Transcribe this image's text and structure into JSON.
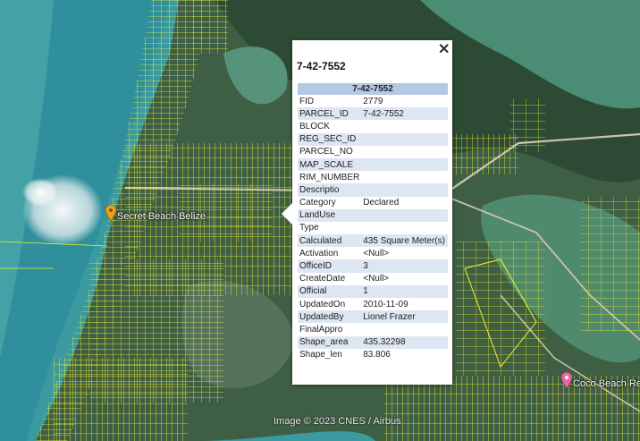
{
  "map": {
    "places": [
      {
        "name": "Secret Beach Belize",
        "pin_color": "#e8a21c"
      },
      {
        "name": "Coco Beach Re",
        "pin_color": "#e86aa0"
      }
    ],
    "credit": "Image © 2023 CNES / Airbus",
    "parcel_color": "#f2f22a",
    "water_color": "#3f9fa0"
  },
  "popup": {
    "title": "7-42-7552",
    "close_icon": "close-icon",
    "table_header": "7-42-7552",
    "rows": [
      {
        "k": "FID",
        "v": "2779"
      },
      {
        "k": "PARCEL_ID",
        "v": "7-42-7552"
      },
      {
        "k": "BLOCK",
        "v": ""
      },
      {
        "k": "REG_SEC_ID",
        "v": ""
      },
      {
        "k": "PARCEL_NO",
        "v": ""
      },
      {
        "k": "MAP_SCALE",
        "v": ""
      },
      {
        "k": "RIM_NUMBER",
        "v": ""
      },
      {
        "k": "Descriptio",
        "v": ""
      },
      {
        "k": "Category",
        "v": "Declared"
      },
      {
        "k": "LandUse",
        "v": ""
      },
      {
        "k": "Type",
        "v": ""
      },
      {
        "k": "Calculated",
        "v": "435 Square Meter(s)"
      },
      {
        "k": "Activation",
        "v": "<Null>"
      },
      {
        "k": "OfficeID",
        "v": "3"
      },
      {
        "k": "CreateDate",
        "v": "<Null>"
      },
      {
        "k": "Official",
        "v": "1"
      },
      {
        "k": "UpdatedOn",
        "v": "2010-11-09"
      },
      {
        "k": "UpdatedBy",
        "v": "Lionel Frazer"
      },
      {
        "k": "FinalAppro",
        "v": ""
      },
      {
        "k": "Shape_area",
        "v": "435.32298"
      },
      {
        "k": "Shape_len",
        "v": "83.806"
      }
    ]
  }
}
